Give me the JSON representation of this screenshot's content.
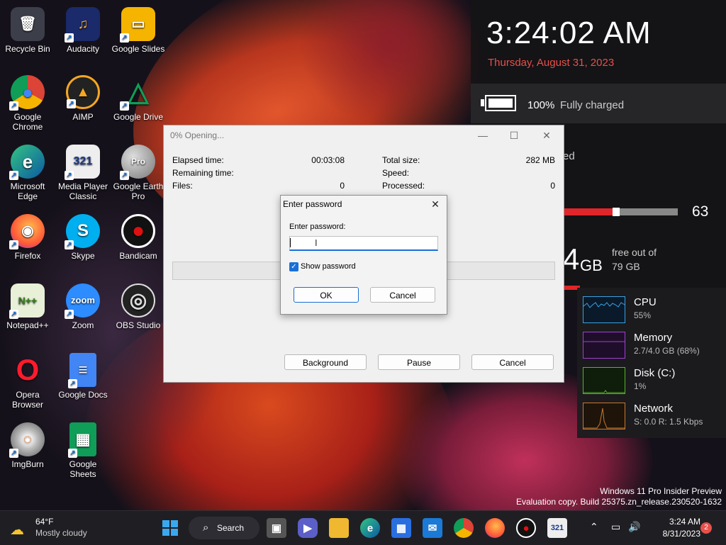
{
  "desktop": {
    "icons": [
      {
        "label": "Recycle Bin",
        "glyph": "🗑"
      },
      {
        "label": "Audacity",
        "glyph": "♫"
      },
      {
        "label": "Google Slides",
        "glyph": "▭"
      },
      {
        "label": "Google Chrome",
        "glyph": "●"
      },
      {
        "label": "AIMP",
        "glyph": "▲"
      },
      {
        "label": "Google Drive",
        "glyph": "△"
      },
      {
        "label": "Microsoft Edge",
        "glyph": "e"
      },
      {
        "label": "Media Player Classic",
        "glyph": "321"
      },
      {
        "label": "Google Earth Pro",
        "glyph": "Pro"
      },
      {
        "label": "Firefox",
        "glyph": "◉"
      },
      {
        "label": "Skype",
        "glyph": "S"
      },
      {
        "label": "Bandicam",
        "glyph": "●"
      },
      {
        "label": "Notepad++",
        "glyph": "N++"
      },
      {
        "label": "Zoom",
        "glyph": "zoom"
      },
      {
        "label": "OBS Studio",
        "glyph": "◎"
      },
      {
        "label": "Opera Browser",
        "glyph": "O"
      },
      {
        "label": "Google Docs",
        "glyph": "≡"
      },
      {
        "label": "ImgBurn",
        "glyph": "◌"
      },
      {
        "label": "Google Sheets",
        "glyph": "▦"
      }
    ]
  },
  "widgets": {
    "time": "3:24:02 AM",
    "date": "Thursday, August 31, 2023",
    "battery_percent": "100%",
    "battery_status": "Fully charged",
    "partial_text_1": "ed",
    "gauge_value": "63",
    "disk_big": "4",
    "disk_unit": "GB",
    "disk_free_label": "free out of",
    "disk_total": "79 GB"
  },
  "monitor": {
    "rows": [
      {
        "name": "CPU",
        "value": "55%",
        "color": "#3aa0e0"
      },
      {
        "name": "Memory",
        "value": "2.7/4.0 GB (68%)",
        "color": "#a040d0"
      },
      {
        "name": "Disk (C:)",
        "value": "1%",
        "color": "#5cb030"
      },
      {
        "name": "Network",
        "value": "S: 0.0 R: 1.5 Kbps",
        "color": "#c87830"
      }
    ]
  },
  "progress_window": {
    "title": "0% Opening...",
    "elapsed_label": "Elapsed time:",
    "elapsed_value": "00:03:08",
    "remaining_label": "Remaining time:",
    "files_label": "Files:",
    "files_value": "0",
    "total_size_label": "Total size:",
    "total_size_value": "282 MB",
    "speed_label": "Speed:",
    "processed_label": "Processed:",
    "processed_value": "0",
    "background_button": "Background",
    "pause_button": "Pause",
    "cancel_button": "Cancel"
  },
  "password_dialog": {
    "title": "Enter password",
    "field_label": "Enter password:",
    "value": "",
    "show_password_label": "Show password",
    "show_password_checked": true,
    "ok_button": "OK",
    "cancel_button": "Cancel"
  },
  "taskbar": {
    "weather_temp": "64°F",
    "weather_desc": "Mostly cloudy",
    "search_label": "Search",
    "clock_time": "3:24 AM",
    "clock_date": "8/31/2023",
    "notification_count": "2"
  },
  "watermark": {
    "line1": "Windows 11 Pro Insider Preview",
    "line2": "Evaluation copy. Build 25375.zn_release.230520-1632"
  }
}
